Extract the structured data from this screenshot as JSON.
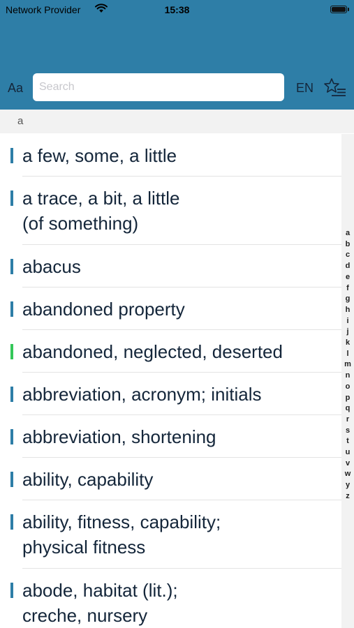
{
  "status_bar": {
    "carrier": "Network Provider",
    "time": "15:38"
  },
  "header": {
    "text_size_button": "Aa",
    "search_placeholder": "Search",
    "language_button": "EN"
  },
  "section": {
    "label": "a"
  },
  "entries": [
    {
      "lines": [
        "a few, some, a little"
      ],
      "marker_color": "#2e7ea7"
    },
    {
      "lines": [
        "a trace, a bit, a little",
        "(of something)"
      ],
      "marker_color": "#2e7ea7"
    },
    {
      "lines": [
        "abacus"
      ],
      "marker_color": "#2e7ea7"
    },
    {
      "lines": [
        "abandoned property"
      ],
      "marker_color": "#2e7ea7"
    },
    {
      "lines": [
        "abandoned, neglected, deserted"
      ],
      "marker_color": "#34c759"
    },
    {
      "lines": [
        "abbreviation, acronym; initials"
      ],
      "marker_color": "#2e7ea7"
    },
    {
      "lines": [
        "abbreviation, shortening"
      ],
      "marker_color": "#2e7ea7"
    },
    {
      "lines": [
        "ability, capability"
      ],
      "marker_color": "#2e7ea7"
    },
    {
      "lines": [
        "ability, fitness, capability;",
        "physical fitness"
      ],
      "marker_color": "#2e7ea7"
    },
    {
      "lines": [
        "abode, habitat (lit.);",
        "creche, nursery"
      ],
      "marker_color": "#2e7ea7"
    }
  ],
  "index_letters": [
    "a",
    "b",
    "c",
    "d",
    "e",
    "f",
    "g",
    "h",
    "i",
    "j",
    "k",
    "l",
    "m",
    "n",
    "o",
    "p",
    "q",
    "r",
    "s",
    "t",
    "u",
    "v",
    "w",
    "y",
    "z"
  ],
  "colors": {
    "header_bg": "#2e7ea7",
    "accent": "#2e7ea7",
    "highlight": "#34c759",
    "text": "#14263a"
  }
}
